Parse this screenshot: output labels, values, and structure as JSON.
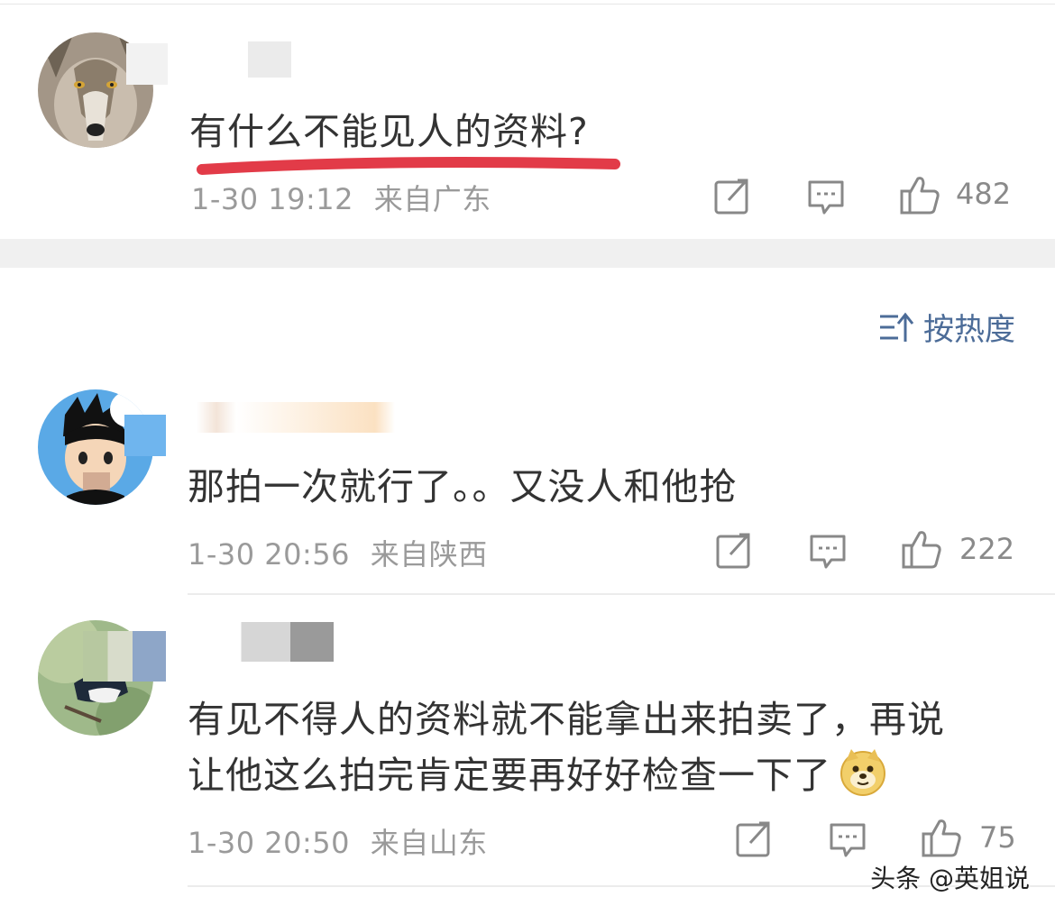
{
  "comments": [
    {
      "text": "有什么不能见人的资料?",
      "time": "1-30 19:12",
      "location": "来自广东",
      "likes": "482",
      "underline_color": "#e23b48"
    },
    {
      "text": "那拍一次就行了。。又没人和他抢",
      "time": "1-30 20:56",
      "location": "来自陕西",
      "likes": "222"
    },
    {
      "text_line1": "有见不得人的资料就不能拿出来拍卖了，再说",
      "text_line2": "让他这么拍完肯定要再好好检查一下了",
      "time": "1-30 20:50",
      "location": "来自山东",
      "likes": "75",
      "emoji": "doge-emoji"
    }
  ],
  "sort": {
    "label": "按热度",
    "icon": "sort-icon"
  },
  "icons": {
    "share": "share-icon",
    "reply": "comment-icon",
    "like": "thumbs-up-icon"
  },
  "watermark": "头条 @英姐说",
  "colors": {
    "link": "#4c6c98",
    "meta": "#9a9a9a",
    "underline": "#e23b48"
  }
}
